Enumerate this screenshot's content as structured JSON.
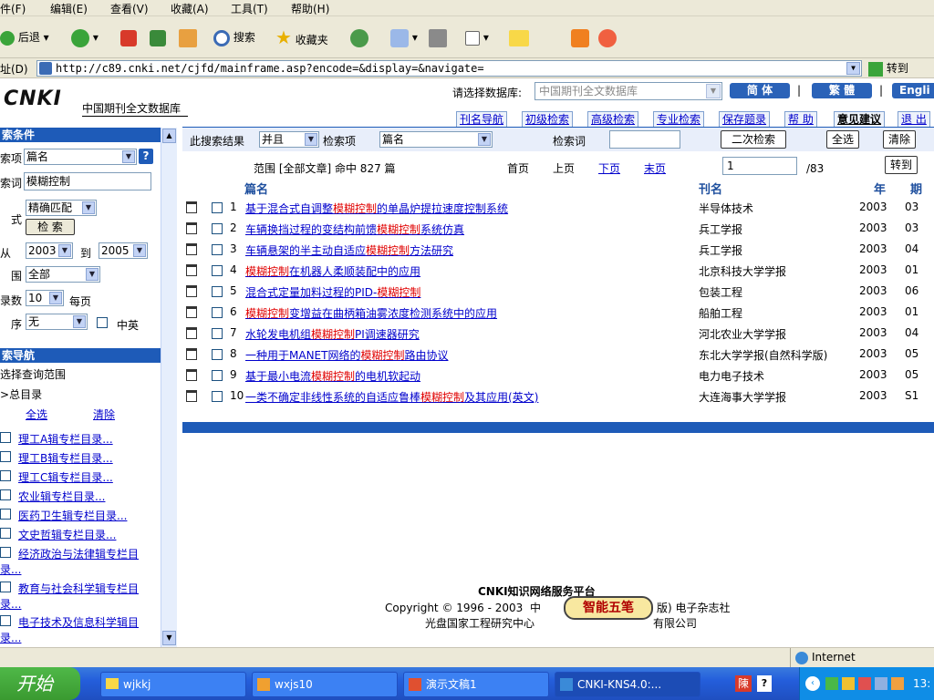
{
  "menu": [
    "件(F)",
    "编辑(E)",
    "查看(V)",
    "收藏(A)",
    "工具(T)",
    "帮助(H)"
  ],
  "toolbar": {
    "back": "后退",
    "search": "搜索",
    "favorites": "收藏夹"
  },
  "address": {
    "label": "址(D)",
    "url": "http://c89.cnki.net/cjfd/mainframe.asp?encode=&display=&navigate=",
    "go": "转到"
  },
  "header": {
    "logo": "CNKI",
    "db_name": "中国期刊全文数据库",
    "select_db_label": "请选择数据库:",
    "select_db_value": "中国期刊全文数据库",
    "lang_simplified": "简 体",
    "lang_traditional": "繁 體",
    "lang_english": "Engli",
    "nav": [
      "刊名导航",
      "初级检索",
      "高级检索",
      "专业检索",
      "保存题录",
      "帮 助",
      "意见建议",
      "退 出"
    ]
  },
  "left": {
    "cond_title": "索条件",
    "field_label": "索项",
    "field_value": "篇名",
    "word_label": "索词",
    "word_value": "模糊控制",
    "match_value": "精确匹配",
    "mode_label": "式",
    "search_btn": "检 索",
    "from_label": "从",
    "from_year": "2003",
    "to_label": "到",
    "to_year": "2005",
    "range_label": "围",
    "range_value": "全部",
    "count_label": "录数",
    "count_value": "10",
    "per_page": "每页",
    "order_label": "序",
    "order_value": "无",
    "zhongying": "中英",
    "nav_title": "索导航",
    "nav_hint": "选择查询范围",
    "tree_root": "总目录",
    "select_all": "全选",
    "clear": "清除",
    "cats": [
      "理工A辑专栏目录...",
      "理工B辑专栏目录...",
      "理工C辑专栏目录...",
      "农业辑专栏目录...",
      "医药卫生辑专栏目录...",
      "文史哲辑专栏目录...",
      "经济政治与法律辑专栏目",
      "录...",
      "教育与社会科学辑专栏目",
      "录...",
      "电子技术及信息科学辑目",
      "录..."
    ]
  },
  "search": {
    "within_label": "此搜索结果",
    "logic_value": "并且",
    "field_label": "检索项",
    "field_value": "篇名",
    "word_label": "检索词",
    "second_search": "二次检索",
    "select_all": "全选",
    "clear": "清除",
    "range_text": "范围 [全部文章] 命中 827 篇",
    "first": "首页",
    "prev": "上页",
    "next": "下页",
    "last": "末页",
    "page_value": "1",
    "page_total": "/83",
    "goto": "转到"
  },
  "columns": {
    "title": "篇名",
    "journal": "刊名",
    "year": "年",
    "issue": "期"
  },
  "results": [
    {
      "n": "1",
      "pre": "基于混合式自调整",
      "hl": "模糊控制",
      "post": "的单晶炉提拉速度控制系统",
      "journal": "半导体技术",
      "year": "2003",
      "issue": "03"
    },
    {
      "n": "2",
      "pre": "车辆换挡过程的变结构前馈",
      "hl": "模糊控制",
      "post": "系统仿真",
      "journal": "兵工学报",
      "year": "2003",
      "issue": "03"
    },
    {
      "n": "3",
      "pre": "车辆悬架的半主动自适应",
      "hl": "模糊控制",
      "post": "方法研究",
      "journal": "兵工学报",
      "year": "2003",
      "issue": "04"
    },
    {
      "n": "4",
      "pre": "",
      "hl": "模糊控制",
      "post": "在机器人柔顺装配中的应用",
      "journal": "北京科技大学学报",
      "year": "2003",
      "issue": "01"
    },
    {
      "n": "5",
      "pre": "混合式定量加料过程的PID-",
      "hl": "模糊控制",
      "post": "",
      "journal": "包装工程",
      "year": "2003",
      "issue": "06"
    },
    {
      "n": "6",
      "pre": "",
      "hl": "模糊控制",
      "post": "变增益在曲柄箱油雾浓度检测系统中的应用",
      "journal": "船舶工程",
      "year": "2003",
      "issue": "01"
    },
    {
      "n": "7",
      "pre": "水轮发电机组",
      "hl": "模糊控制",
      "post": "PI调速器研究",
      "journal": "河北农业大学学报",
      "year": "2003",
      "issue": "04"
    },
    {
      "n": "8",
      "pre": "一种用于MANET网络的",
      "hl": "模糊控制",
      "post": "路由协议",
      "journal": "东北大学学报(自然科学版)",
      "year": "2003",
      "issue": "05"
    },
    {
      "n": "9",
      "pre": "基于最小电流",
      "hl": "模糊控制",
      "post": "的电机软起动",
      "journal": "电力电子技术",
      "year": "2003",
      "issue": "05"
    },
    {
      "n": "10",
      "pre": "一类不确定非线性系统的自适应鲁棒",
      "hl": "模糊控制",
      "post": "及其应用(英文)",
      "journal": "大连海事大学学报",
      "year": "2003",
      "issue": "S1"
    }
  ],
  "footer": {
    "platform": "CNKI知识网络服务平台",
    "copyright_a": "Copyright © 1996 - 2003",
    "copyright_b": "中",
    "copyright_c": "版) 电子杂志社",
    "line2_a": "光盘国家工程研究中心",
    "line2_b": "有限公司",
    "stamp": "智能五笔"
  },
  "status": {
    "zone": "Internet"
  },
  "taskbar": {
    "start": "开始",
    "tasks": [
      "wjkkj",
      "wxjs10",
      "演示文稿1",
      "CNKI-KNS4.0:..."
    ],
    "clock": "13:"
  },
  "colors": {
    "brand_blue": "#1e5bb8",
    "link": "#0000cc",
    "highlight": "#e00000"
  }
}
